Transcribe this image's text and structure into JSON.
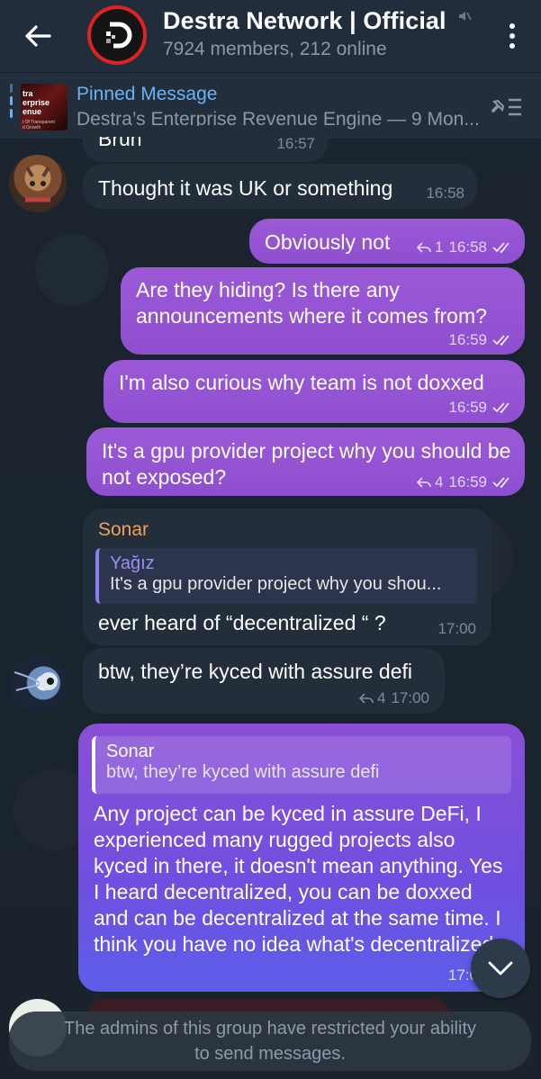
{
  "header": {
    "title": "Destra Network | Official",
    "subtitle": "7924 members, 212 online"
  },
  "pinned": {
    "label": "Pinned Message",
    "text": "Destra’s Enterprise Revenue Engine — 9 Mon...",
    "thumb_line1": "tra\nerprise\nenue",
    "thumb_line2": "l Of Transparent\nd Growth"
  },
  "messages": [
    {
      "id": "m0",
      "text": "Bruh",
      "time": "16:57"
    },
    {
      "id": "m1",
      "text": "Thought it was UK or something",
      "time": "16:58"
    },
    {
      "id": "m2",
      "text": "Obviously not",
      "replies": "1",
      "time": "16:58"
    },
    {
      "id": "m3",
      "text": "Are they hiding? Is there any announcements where it comes from?",
      "time": "16:59"
    },
    {
      "id": "m4",
      "text": "I'm also curious why team is not doxxed",
      "time": "16:59"
    },
    {
      "id": "m5",
      "text": "It's a gpu provider project why you should be not exposed?",
      "replies": "4",
      "time": "16:59"
    },
    {
      "id": "m6",
      "sender": "Sonar",
      "quote_name": "Yağız",
      "quote_text": "It's a gpu provider project why you shou...",
      "text": "ever heard of “decentralized “ ?",
      "time": "17:00"
    },
    {
      "id": "m7",
      "text": "btw, they’re kyced with assure defi",
      "replies": "4",
      "time": "17:00"
    },
    {
      "id": "m8",
      "quote_name": "Sonar",
      "quote_text": "btw, they’re kyced with assure defi",
      "text": "Any project can be kyced in assure DeFi, I experienced many rugged projects also kyced in there, it doesn't mean anything. Yes I heard decentralized, you can be doxxed and can be decentralized at the same time. I think you have no idea what's decentralized",
      "time": "17:0"
    }
  ],
  "bottom_bar": {
    "line1": "The admins of this group have restricted your ability",
    "line2": "to send messages."
  },
  "colors": {
    "header_bg": "#212d3b",
    "out_bubble": "#9b59d6",
    "in_bubble": "#222e3a",
    "link_blue": "#6ab2f2",
    "sender_orange": "#f0a05c"
  }
}
